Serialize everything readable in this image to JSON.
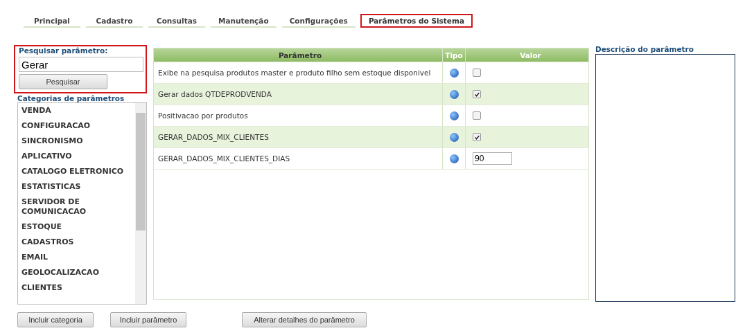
{
  "tabs": [
    {
      "label": "Principal",
      "selected": false,
      "highlighted": false
    },
    {
      "label": "Cadastro",
      "selected": false,
      "highlighted": false
    },
    {
      "label": "Consultas",
      "selected": false,
      "highlighted": false
    },
    {
      "label": "Manutenção",
      "selected": false,
      "highlighted": false
    },
    {
      "label": "Configurações",
      "selected": false,
      "highlighted": false
    },
    {
      "label": "Parâmetros do Sistema",
      "selected": true,
      "highlighted": true
    }
  ],
  "search": {
    "label": "Pesquisar parâmetro:",
    "value": "Gerar",
    "button": "Pesquisar",
    "highlighted": true
  },
  "categories": {
    "title": "Categorias de parâmetros",
    "items": [
      "VENDA",
      "CONFIGURACAO",
      "SINCRONISMO",
      "APLICATIVO",
      "CATALOGO ELETRONICO",
      "ESTATISTICAS",
      "SERVIDOR DE COMUNICACAO",
      "ESTOQUE",
      "CADASTROS",
      "EMAIL",
      "GEOLOCALIZACAO",
      "CLIENTES"
    ]
  },
  "table": {
    "columns": [
      "Parâmetro",
      "Tipo",
      "Valor"
    ],
    "rows": [
      {
        "name": "Exibe na pesquisa produtos master e produto filho sem estoque disponivel",
        "kind": "checkbox",
        "checked": false
      },
      {
        "name": "Gerar dados QTDEPRODVENDA",
        "kind": "checkbox",
        "checked": true
      },
      {
        "name": "Positivacao por produtos",
        "kind": "checkbox",
        "checked": false
      },
      {
        "name": "GERAR_DADOS_MIX_CLIENTES",
        "kind": "checkbox",
        "checked": true
      },
      {
        "name": "GERAR_DADOS_MIX_CLIENTES_DIAS",
        "kind": "text",
        "value": "90"
      }
    ]
  },
  "description": {
    "title": "Descrição do parâmetro"
  },
  "buttons": [
    "Incluir categoria",
    "Incluir parâmetro",
    "Alterar detalhes do parâmetro"
  ]
}
